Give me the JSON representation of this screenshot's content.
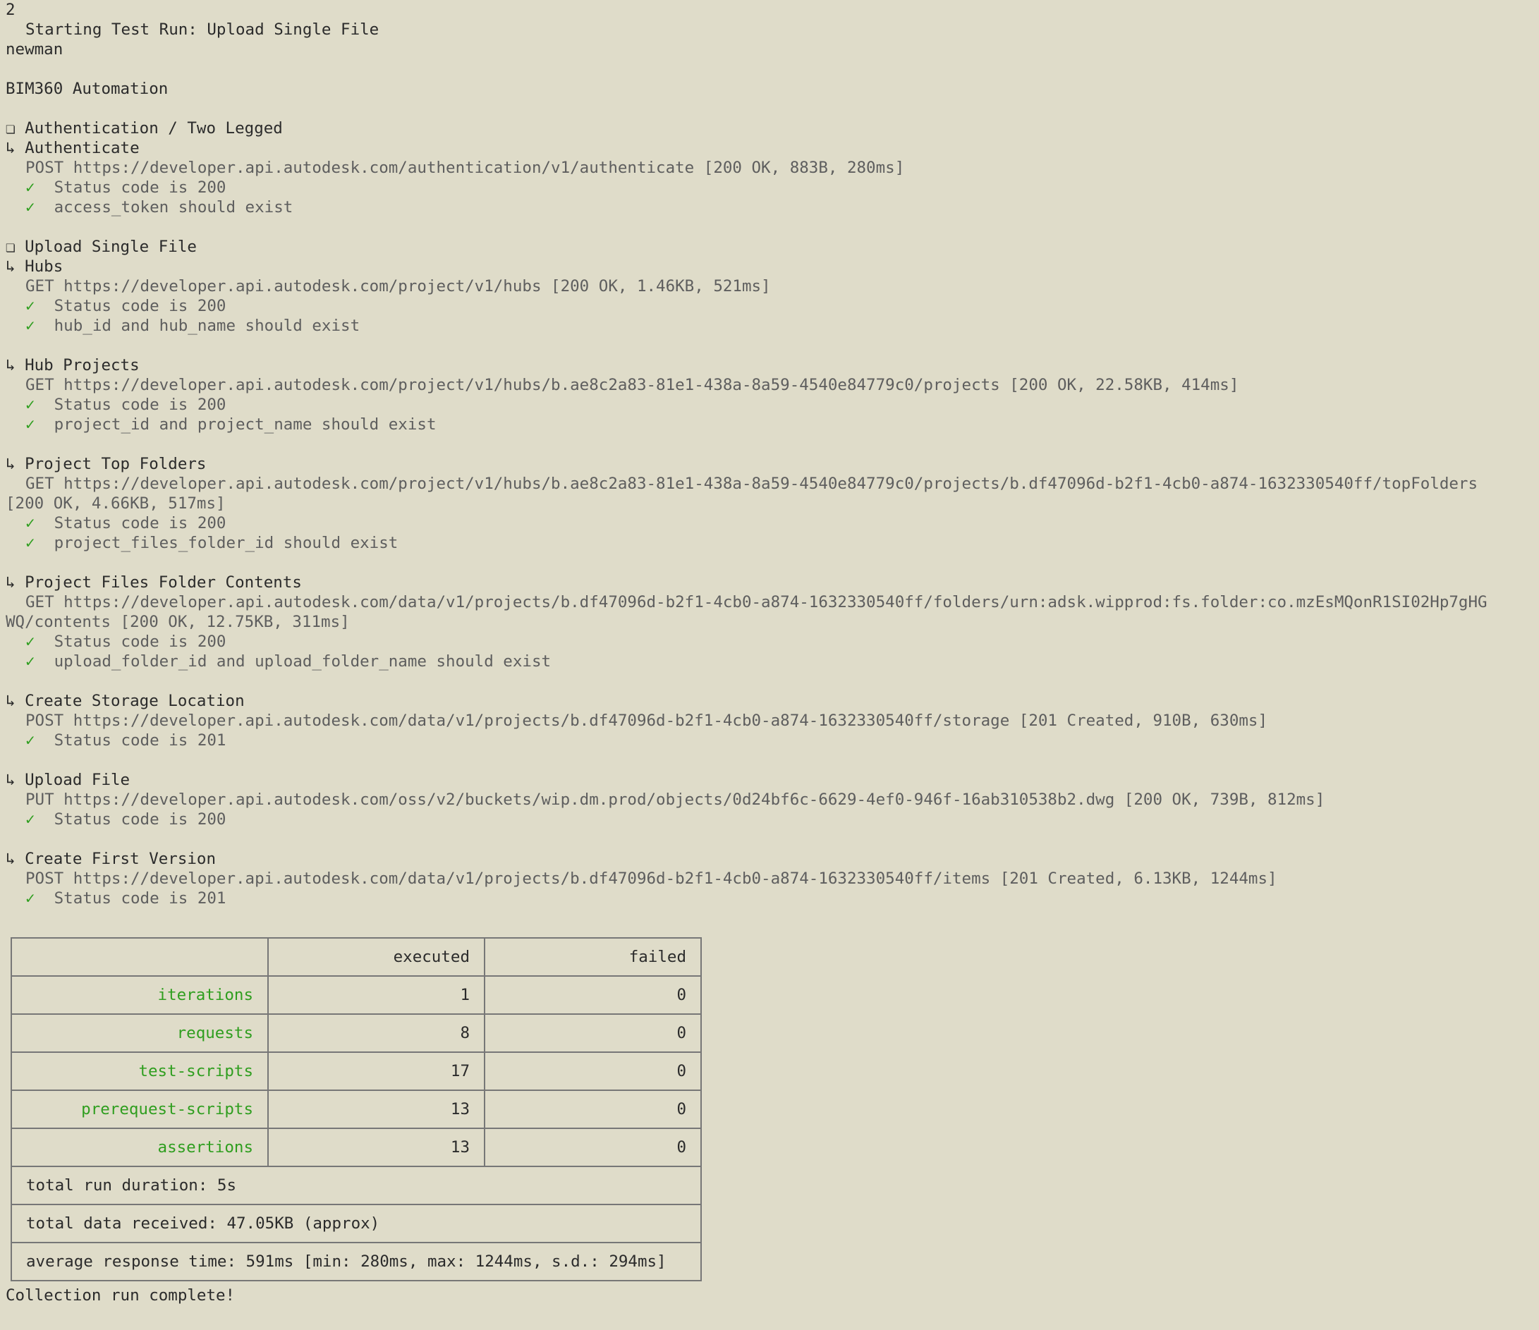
{
  "header": {
    "line_number": "2",
    "starting": "Starting Test Run: Upload Single File",
    "tool": "newman",
    "collection": "BIM360 Automation"
  },
  "groups": [
    {
      "title": "Authentication / Two Legged",
      "requests": [
        {
          "name": "Authenticate",
          "request": "POST https://developer.api.autodesk.com/authentication/v1/authenticate [200 OK, 883B, 280ms]",
          "checks": [
            "Status code is 200",
            "access_token should exist"
          ]
        }
      ]
    },
    {
      "title": "Upload Single File",
      "requests": [
        {
          "name": "Hubs",
          "request": "GET https://developer.api.autodesk.com/project/v1/hubs [200 OK, 1.46KB, 521ms]",
          "checks": [
            "Status code is 200",
            "hub_id and hub_name should exist"
          ]
        },
        {
          "name": "Hub Projects",
          "request": "GET https://developer.api.autodesk.com/project/v1/hubs/b.ae8c2a83-81e1-438a-8a59-4540e84779c0/projects [200 OK, 22.58KB, 414ms]",
          "checks": [
            "Status code is 200",
            "project_id and project_name should exist"
          ]
        },
        {
          "name": "Project Top Folders",
          "request": "GET https://developer.api.autodesk.com/project/v1/hubs/b.ae8c2a83-81e1-438a-8a59-4540e84779c0/projects/b.df47096d-b2f1-4cb0-a874-1632330540ff/topFolders",
          "request_cont": "[200 OK, 4.66KB, 517ms]",
          "checks": [
            "Status code is 200",
            "project_files_folder_id should exist"
          ]
        },
        {
          "name": "Project Files Folder Contents",
          "request": "GET https://developer.api.autodesk.com/data/v1/projects/b.df47096d-b2f1-4cb0-a874-1632330540ff/folders/urn:adsk.wipprod:fs.folder:co.mzEsMQonR1SI02Hp7gHG",
          "request_cont": "WQ/contents [200 OK, 12.75KB, 311ms]",
          "checks": [
            "Status code is 200",
            "upload_folder_id and upload_folder_name should exist"
          ]
        },
        {
          "name": "Create Storage Location",
          "request": "POST https://developer.api.autodesk.com/data/v1/projects/b.df47096d-b2f1-4cb0-a874-1632330540ff/storage [201 Created, 910B, 630ms]",
          "checks": [
            "Status code is 201"
          ]
        },
        {
          "name": "Upload File",
          "request": "PUT https://developer.api.autodesk.com/oss/v2/buckets/wip.dm.prod/objects/0d24bf6c-6629-4ef0-946f-16ab310538b2.dwg [200 OK, 739B, 812ms]",
          "checks": [
            "Status code is 200"
          ]
        },
        {
          "name": "Create First Version",
          "request": "POST https://developer.api.autodesk.com/data/v1/projects/b.df47096d-b2f1-4cb0-a874-1632330540ff/items [201 Created, 6.13KB, 1244ms]",
          "checks": [
            "Status code is 201"
          ]
        }
      ]
    }
  ],
  "symbols": {
    "group": "❏",
    "request": "↳",
    "check": "✓"
  },
  "summary": {
    "headers": [
      "",
      "executed",
      "failed"
    ],
    "rows": [
      {
        "label": "iterations",
        "executed": "1",
        "failed": "0"
      },
      {
        "label": "requests",
        "executed": "8",
        "failed": "0"
      },
      {
        "label": "test-scripts",
        "executed": "17",
        "failed": "0"
      },
      {
        "label": "prerequest-scripts",
        "executed": "13",
        "failed": "0"
      },
      {
        "label": "assertions",
        "executed": "13",
        "failed": "0"
      }
    ],
    "footer": [
      "total run duration: 5s",
      "total data received: 47.05KB (approx)",
      "average response time: 591ms [min: 280ms, max: 1244ms, s.d.: 294ms]"
    ]
  },
  "footer_text": "Collection run complete!",
  "colors": {
    "background": "#dfdcc9",
    "text": "#2b2b2b",
    "request_text": "#5e5e5e",
    "pass": "#2f9e1f",
    "table_border": "#777777"
  }
}
